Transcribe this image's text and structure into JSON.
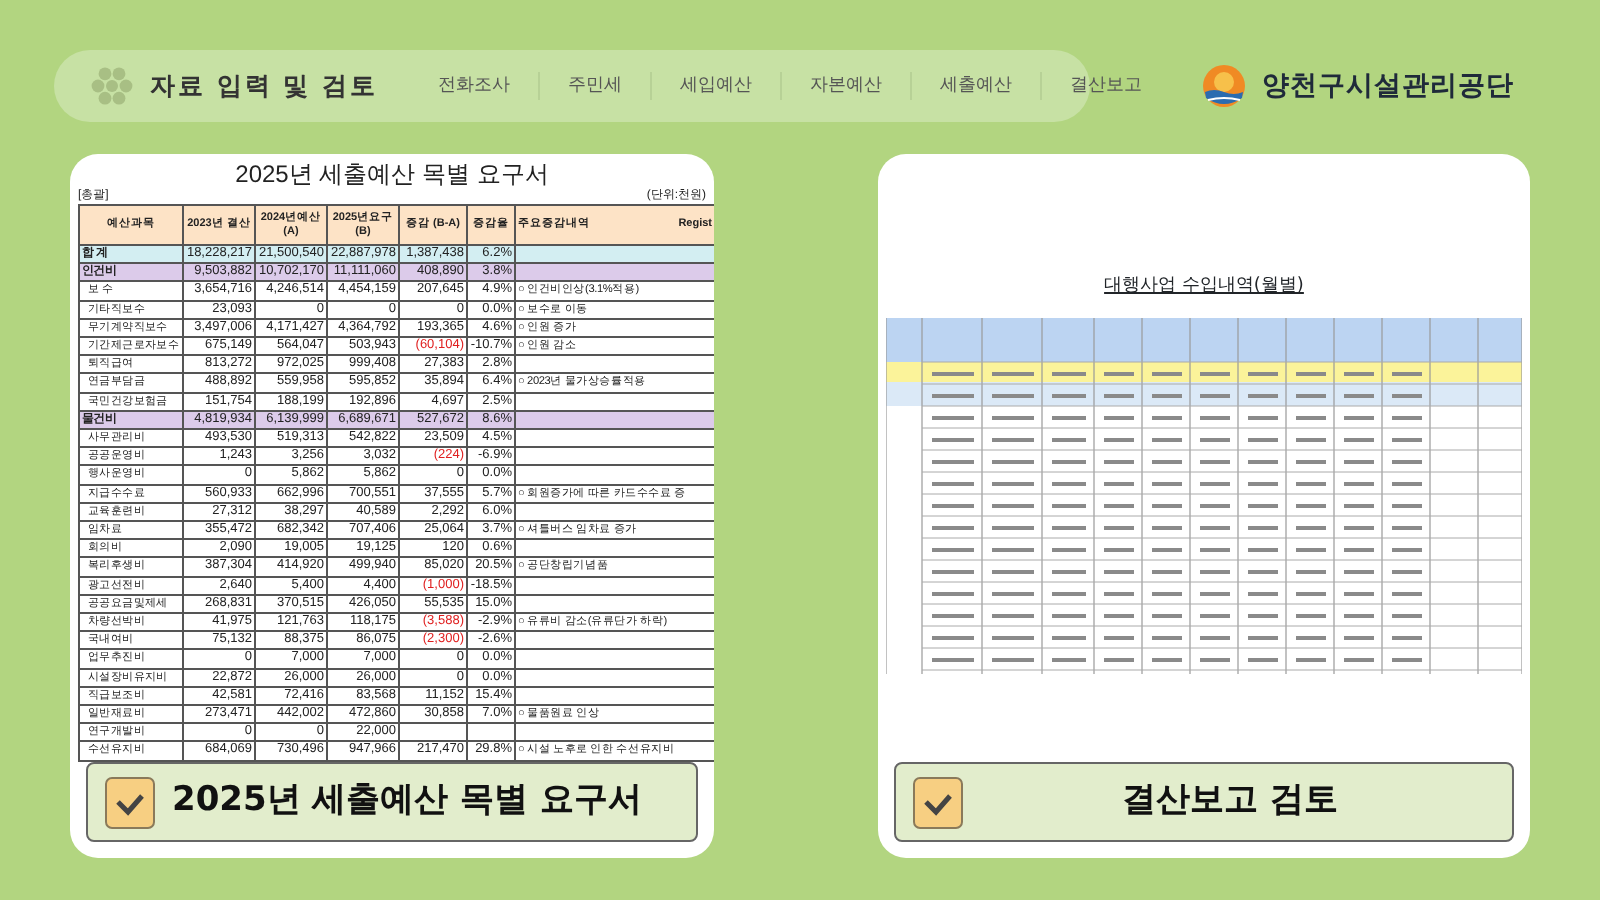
{
  "nav": {
    "title": "자료 입력 및 검토",
    "items": [
      {
        "label": "전화조사"
      },
      {
        "label": "주민세"
      },
      {
        "label": "세입예산"
      },
      {
        "label": "자본예산"
      },
      {
        "label": "세출예산"
      },
      {
        "label": "결산보고"
      }
    ]
  },
  "brand": {
    "name": "양천구시설관리공단"
  },
  "cards": [
    {
      "kind": "table",
      "document": {
        "title": "2025년 세출예산 목별 요구서",
        "scope": "[총괄]",
        "unit": "(단위:천원)",
        "note": "Regist",
        "columns": [
          "예산과목",
          "2023년 결산",
          "2024년예산 (A)",
          "2025년요구 (B)",
          "증감 (B-A)",
          "증감율",
          "주요증감내역"
        ],
        "rows": [
          {
            "kind": "total",
            "decrease": false,
            "cells": [
              "합 계",
              "18,228,217",
              "21,500,540",
              "22,887,978",
              "1,387,438",
              "6.2%",
              ""
            ]
          },
          {
            "kind": "group",
            "decrease": false,
            "cells": [
              "인건비",
              "9,503,882",
              "10,702,170",
              "11,111,060",
              "408,890",
              "3.8%",
              ""
            ]
          },
          {
            "kind": "item",
            "decrease": false,
            "cells": [
              "보 수",
              "3,654,716",
              "4,246,514",
              "4,454,159",
              "207,645",
              "4.9%",
              "○ 인건비인상(3.1%적용)"
            ]
          },
          {
            "kind": "item",
            "decrease": false,
            "cells": [
              "기타직보수",
              "23,093",
              "0",
              "0",
              "0",
              "0.0%",
              "○ 보수로 이동"
            ]
          },
          {
            "kind": "item",
            "decrease": false,
            "cells": [
              "무기계약직보수",
              "3,497,006",
              "4,171,427",
              "4,364,792",
              "193,365",
              "4.6%",
              "○ 인원 증가"
            ]
          },
          {
            "kind": "item",
            "decrease": true,
            "cells": [
              "기간제근로자보수",
              "675,149",
              "564,047",
              "503,943",
              "(60,104)",
              "-10.7%",
              "○ 인원 감소"
            ]
          },
          {
            "kind": "item",
            "decrease": false,
            "cells": [
              "퇴직급여",
              "813,272",
              "972,025",
              "999,408",
              "27,383",
              "2.8%",
              ""
            ]
          },
          {
            "kind": "item",
            "decrease": false,
            "cells": [
              "연금부담금",
              "488,892",
              "559,958",
              "595,852",
              "35,894",
              "6.4%",
              "○ 2023년 물가상승률적용"
            ]
          },
          {
            "kind": "item",
            "decrease": false,
            "cells": [
              "국민건강보험금",
              "151,754",
              "188,199",
              "192,896",
              "4,697",
              "2.5%",
              ""
            ]
          },
          {
            "kind": "group",
            "decrease": false,
            "cells": [
              "물건비",
              "4,819,934",
              "6,139,999",
              "6,689,671",
              "527,672",
              "8.6%",
              ""
            ]
          },
          {
            "kind": "item",
            "decrease": false,
            "cells": [
              "사무관리비",
              "493,530",
              "519,313",
              "542,822",
              "23,509",
              "4.5%",
              ""
            ]
          },
          {
            "kind": "item",
            "decrease": true,
            "cells": [
              "공공운영비",
              "1,243",
              "3,256",
              "3,032",
              "(224)",
              "-6.9%",
              ""
            ]
          },
          {
            "kind": "item",
            "decrease": false,
            "cells": [
              "행사운영비",
              "0",
              "5,862",
              "5,862",
              "0",
              "0.0%",
              ""
            ]
          },
          {
            "kind": "item",
            "decrease": false,
            "cells": [
              "지급수수료",
              "560,933",
              "662,996",
              "700,551",
              "37,555",
              "5.7%",
              "○ 회원증가에 따른 카드수수료 증"
            ]
          },
          {
            "kind": "item",
            "decrease": false,
            "cells": [
              "교육훈련비",
              "27,312",
              "38,297",
              "40,589",
              "2,292",
              "6.0%",
              ""
            ]
          },
          {
            "kind": "item",
            "decrease": false,
            "cells": [
              "임차료",
              "355,472",
              "682,342",
              "707,406",
              "25,064",
              "3.7%",
              "○ 셔틀버스 임차료 증가"
            ]
          },
          {
            "kind": "item",
            "decrease": false,
            "cells": [
              "회의비",
              "2,090",
              "19,005",
              "19,125",
              "120",
              "0.6%",
              ""
            ]
          },
          {
            "kind": "item",
            "decrease": false,
            "cells": [
              "복리후생비",
              "387,304",
              "414,920",
              "499,940",
              "85,020",
              "20.5%",
              "○ 공단창립기념품"
            ]
          },
          {
            "kind": "item",
            "decrease": true,
            "cells": [
              "광고선전비",
              "2,640",
              "5,400",
              "4,400",
              "(1,000)",
              "-18.5%",
              ""
            ]
          },
          {
            "kind": "item",
            "decrease": false,
            "cells": [
              "공공요금및제세",
              "268,831",
              "370,515",
              "426,050",
              "55,535",
              "15.0%",
              ""
            ]
          },
          {
            "kind": "item",
            "decrease": true,
            "cells": [
              "차량선박비",
              "41,975",
              "121,763",
              "118,175",
              "(3,588)",
              "-2.9%",
              "○ 유류비 감소(유류단가 하락)"
            ]
          },
          {
            "kind": "item",
            "decrease": true,
            "cells": [
              "국내여비",
              "75,132",
              "88,375",
              "86,075",
              "(2,300)",
              "-2.6%",
              ""
            ]
          },
          {
            "kind": "item",
            "decrease": false,
            "cells": [
              "업무추진비",
              "0",
              "7,000",
              "7,000",
              "0",
              "0.0%",
              ""
            ]
          },
          {
            "kind": "item",
            "decrease": false,
            "cells": [
              "시설장비유지비",
              "22,872",
              "26,000",
              "26,000",
              "0",
              "0.0%",
              ""
            ]
          },
          {
            "kind": "item",
            "decrease": false,
            "cells": [
              "직급보조비",
              "42,581",
              "72,416",
              "83,568",
              "11,152",
              "15.4%",
              ""
            ]
          },
          {
            "kind": "item",
            "decrease": false,
            "cells": [
              "일반재료비",
              "273,471",
              "442,002",
              "472,860",
              "30,858",
              "7.0%",
              "○ 물품원료 인상"
            ]
          },
          {
            "kind": "item",
            "cells": [
              "연구개발비",
              "0",
              "0",
              "22,000",
              "",
              "",
              ""
            ]
          },
          {
            "kind": "item",
            "decrease": false,
            "cells": [
              "수선유지비",
              "684,069",
              "730,496",
              "947,966",
              "217,470",
              "29.8%",
              "○ 시설 노후로 인한 수선유지비"
            ]
          }
        ]
      },
      "button": "2025년 세출예산 목별 요구서"
    },
    {
      "kind": "drawing",
      "document": {
        "title": "대행사업 수입내역(월별)"
      },
      "button": "결산보고 검토"
    }
  ]
}
